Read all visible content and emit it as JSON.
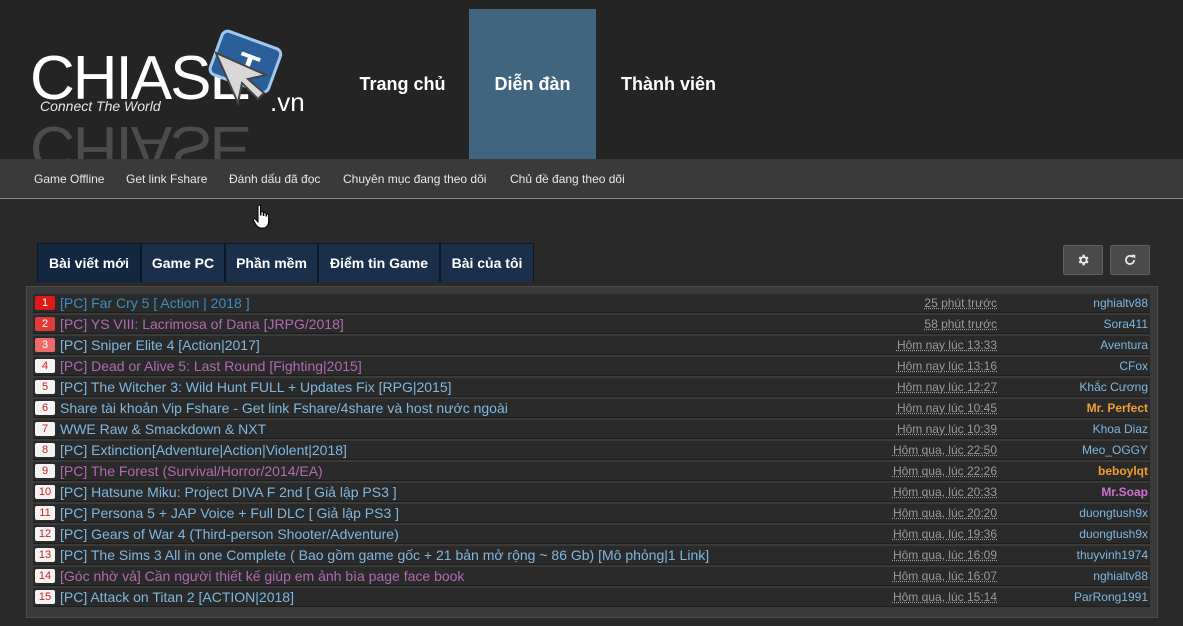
{
  "logo": {
    "brand": "CHIASE",
    "tagline": "Connect The World",
    "tld": ".vn"
  },
  "nav": [
    {
      "label": "Trang chủ",
      "active": false
    },
    {
      "label": "Diễn đàn",
      "active": true
    },
    {
      "label": "Thành viên",
      "active": false
    }
  ],
  "subnav": [
    "Game Offline",
    "Get link Fshare",
    "Đánh dấu đã đọc",
    "Chuyên mục đang theo dõi",
    "Chủ đề đang theo dõi"
  ],
  "tabs": [
    {
      "label": "Bài viết mới",
      "active": true
    },
    {
      "label": "Game PC",
      "active": false
    },
    {
      "label": "Phần mềm",
      "active": false
    },
    {
      "label": "Điểm tin Game",
      "active": false
    },
    {
      "label": "Bài của tôi",
      "active": false
    }
  ],
  "icons": {
    "settings": "gear-icon",
    "refresh": "refresh-icon"
  },
  "rows": [
    {
      "rank": "1",
      "title": "[PC] Far Cry 5 [ Action | 2018 ]",
      "time": "25 phút trước",
      "user": "nghialtv88",
      "title_color": "#3b8ec4",
      "user_color": "#7fb7e0",
      "rank_bg": "#e01818",
      "rank_fg": "#ffffff",
      "bold": false
    },
    {
      "rank": "2",
      "title": "[PC] YS VIII: Lacrimosa of Dana [JRPG/2018]",
      "time": "58 phút trước",
      "user": "Sora411",
      "title_color": "#b06bb0",
      "user_color": "#7fb7e0",
      "rank_bg": "#e23a3a",
      "rank_fg": "#ffffff",
      "bold": false
    },
    {
      "rank": "3",
      "title": "[PC] Sniper Elite 4 [Action|2017]",
      "time": "Hôm nay lúc 13:33",
      "user": "Aventura",
      "title_color": "#7fb7e0",
      "user_color": "#7fb7e0",
      "rank_bg": "#ec6a6a",
      "rank_fg": "#ffffff",
      "bold": false
    },
    {
      "rank": "4",
      "title": "[PC] Dead or Alive 5: Last Round [Fighting|2015]",
      "time": "Hôm nay lúc 13:16",
      "user": "CFox",
      "title_color": "#b06bb0",
      "user_color": "#7fb7e0",
      "rank_bg": "#f3f3f3",
      "rank_fg": "#d02020",
      "bold": false
    },
    {
      "rank": "5",
      "title": "[PC] The Witcher 3: Wild Hunt FULL + Updates Fix [RPG|2015]",
      "time": "Hôm nay lúc 12:27",
      "user": "Khắc Cương",
      "title_color": "#7fb7e0",
      "user_color": "#7fb7e0",
      "rank_bg": "#f3f3f3",
      "rank_fg": "#d02020",
      "bold": false
    },
    {
      "rank": "6",
      "title": "Share tài khoản Vip Fshare - Get link Fshare/4share và host nước ngoài",
      "time": "Hôm nay lúc 10:45",
      "user": "Mr. Perfect",
      "title_color": "#7fb7e0",
      "user_color": "#f0a030",
      "rank_bg": "#f3f3f3",
      "rank_fg": "#d02020",
      "bold": true
    },
    {
      "rank": "7",
      "title": "WWE Raw & Smackdown & NXT",
      "time": "Hôm nay lúc 10:39",
      "user": "Khoa Diaz",
      "title_color": "#7fb7e0",
      "user_color": "#7fb7e0",
      "rank_bg": "#f3f3f3",
      "rank_fg": "#d02020",
      "bold": false
    },
    {
      "rank": "8",
      "title": "[PC] Extinction[Adventure|Action|Violent|2018]",
      "time": "Hôm qua, lúc 22:50",
      "user": "Meo_OGGY",
      "title_color": "#7fb7e0",
      "user_color": "#7fb7e0",
      "rank_bg": "#f3f3f3",
      "rank_fg": "#d02020",
      "bold": false
    },
    {
      "rank": "9",
      "title": "[PC] The Forest (Survival/Horror/2014/EA)",
      "time": "Hôm qua, lúc 22:26",
      "user": "beboylqt",
      "title_color": "#b06bb0",
      "user_color": "#f0a030",
      "rank_bg": "#f3f3f3",
      "rank_fg": "#d02020",
      "bold": true
    },
    {
      "rank": "10",
      "title": "[PC] Hatsune Miku: Project DIVA F 2nd [ Giả lập PS3 ]",
      "time": "Hôm qua, lúc 20:33",
      "user": "Mr.Soap",
      "title_color": "#7fb7e0",
      "user_color": "#d070d0",
      "rank_bg": "#f3f3f3",
      "rank_fg": "#d02020",
      "bold": true
    },
    {
      "rank": "11",
      "title": "[PC] Persona 5 + JAP Voice + Full DLC [ Giả lập PS3 ]",
      "time": "Hôm qua, lúc 20:20",
      "user": "duongtush9x",
      "title_color": "#7fb7e0",
      "user_color": "#7fb7e0",
      "rank_bg": "#f3f3f3",
      "rank_fg": "#d02020",
      "bold": false
    },
    {
      "rank": "12",
      "title": "[PC] Gears of War 4 (Third-person Shooter/Adventure)",
      "time": "Hôm qua, lúc 19:36",
      "user": "duongtush9x",
      "title_color": "#7fb7e0",
      "user_color": "#7fb7e0",
      "rank_bg": "#f3f3f3",
      "rank_fg": "#d02020",
      "bold": false
    },
    {
      "rank": "13",
      "title": "[PC] The Sims 3 All in one Complete ( Bao gồm game gốc + 21 bản mở rộng ~ 86 Gb) [Mô phỏng|1 Link]",
      "time": "Hôm qua, lúc 16:09",
      "user": "thuyvinh1974",
      "title_color": "#7fb7e0",
      "user_color": "#7fb7e0",
      "rank_bg": "#f3f3f3",
      "rank_fg": "#d02020",
      "bold": false
    },
    {
      "rank": "14",
      "title": "[Góc nhờ vả] Cần người thiết kế giúp em ảnh bìa page face book",
      "time": "Hôm qua, lúc 16:07",
      "user": "nghialtv88",
      "title_color": "#b06bb0",
      "user_color": "#7fb7e0",
      "rank_bg": "#f3f3f3",
      "rank_fg": "#d02020",
      "bold": false
    },
    {
      "rank": "15",
      "title": "[PC] Attack on Titan 2 [ACTION|2018]",
      "time": "Hôm qua, lúc 15:14",
      "user": "ParRong1991",
      "title_color": "#7fb7e0",
      "user_color": "#7fb7e0",
      "rank_bg": "#f3f3f3",
      "rank_fg": "#d02020",
      "bold": false
    }
  ]
}
